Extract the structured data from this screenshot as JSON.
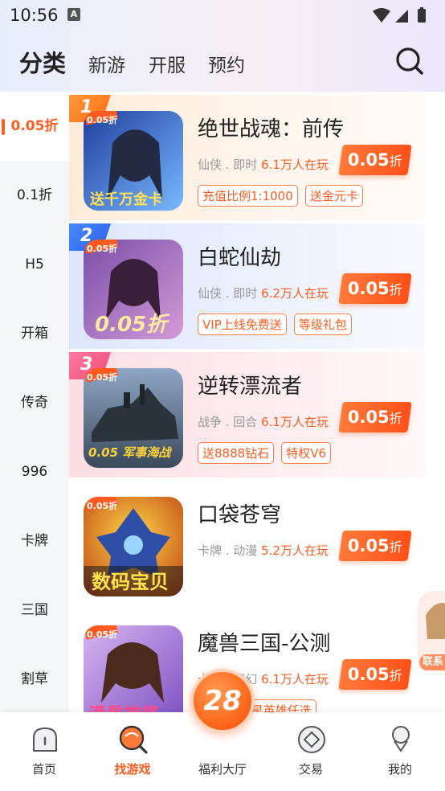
{
  "status_bar": {
    "time": "10:56",
    "notification_glyph": "A"
  },
  "header": {
    "tabs": [
      {
        "label": "分类",
        "active": true
      },
      {
        "label": "新游",
        "active": false
      },
      {
        "label": "开服",
        "active": false
      },
      {
        "label": "预约",
        "active": false
      }
    ],
    "search_icon": "search-icon"
  },
  "sidebar": {
    "items": [
      {
        "label": "0.05折",
        "active": true
      },
      {
        "label": "0.1折"
      },
      {
        "label": "H5"
      },
      {
        "label": "开箱"
      },
      {
        "label": "传奇"
      },
      {
        "label": "996"
      },
      {
        "label": "卡牌"
      },
      {
        "label": "三国"
      },
      {
        "label": "割草"
      }
    ]
  },
  "games": [
    {
      "rank": "1",
      "title": "绝世战魂：前传",
      "genre": "仙侠 . 即时",
      "players": "6.1万人在玩",
      "discount_num": "0.05",
      "discount_unit": "折",
      "tags": [
        "充值比例1:1000",
        "送金元卡"
      ],
      "icon_overlay_top": "0.05折",
      "icon_overlay_bottom": "送千万金卡"
    },
    {
      "rank": "2",
      "title": "白蛇仙劫",
      "genre": "仙侠 . 即时",
      "players": "6.2万人在玩",
      "discount_num": "0.05",
      "discount_unit": "折",
      "tags": [
        "VIP上线免费送",
        "等级礼包"
      ],
      "icon_overlay_top": "0.05折",
      "icon_overlay_bottom": "0.05折"
    },
    {
      "rank": "3",
      "title": "逆转漂流者",
      "genre": "战争 . 回合",
      "players": "6.1万人在玩",
      "discount_num": "0.05",
      "discount_unit": "折",
      "tags": [
        "送8888钻石",
        "特权V6"
      ],
      "icon_overlay_top": "0.05折",
      "icon_overlay_bottom": "0.05 军事海战"
    },
    {
      "rank": "",
      "title": "口袋苍穹",
      "genre": "卡牌 . 动漫",
      "players": "5.2万人在玩",
      "discount_num": "0.05",
      "discount_unit": "折",
      "tags": [],
      "icon_overlay_top": "0.05折",
      "icon_overlay_bottom": "数码宝贝"
    },
    {
      "rank": "",
      "title": "魔兽三国-公测",
      "genre": "卡牌 . 魔幻",
      "players": "6.1万人在玩",
      "discount_num": "0.05",
      "discount_unit": "折",
      "tags": [
        "神将",
        "4星英雄任选"
      ],
      "icon_overlay_top": "0.05折",
      "icon_overlay_bottom": "满星神将"
    }
  ],
  "floating_contact": {
    "label": "联系"
  },
  "bottom_nav": {
    "items": [
      {
        "label": "首页",
        "icon": "home-icon"
      },
      {
        "label": "找游戏",
        "icon": "find-game-icon",
        "active": true
      },
      {
        "label": "福利大厅",
        "icon": "welfare-badge",
        "badge": "28"
      },
      {
        "label": "交易",
        "icon": "trade-icon"
      },
      {
        "label": "我的",
        "icon": "profile-icon"
      }
    ]
  },
  "colors": {
    "accent": "#ff5a1f",
    "sidebar_bg": "#f5f6f8",
    "rank1": "#ff7a20",
    "rank2": "#3a72f2",
    "rank3": "#f25a84"
  }
}
